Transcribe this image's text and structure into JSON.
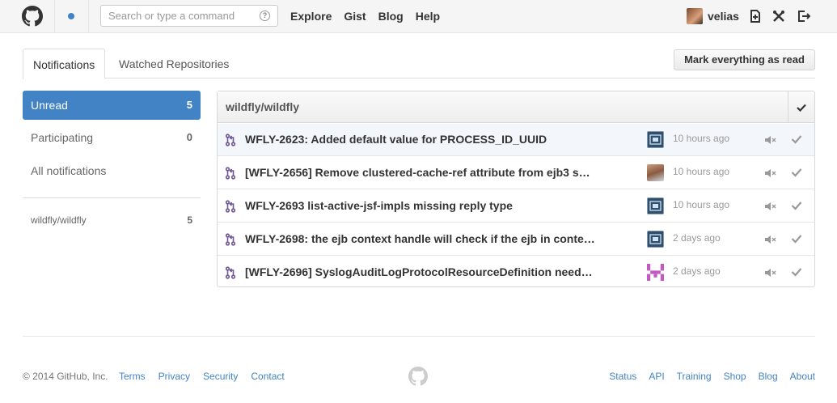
{
  "header": {
    "search_placeholder": "Search or type a command",
    "help_glyph": "?",
    "nav": [
      "Explore",
      "Gist",
      "Blog",
      "Help"
    ],
    "username": "velias",
    "icons": [
      "github-logo-icon",
      "notification-dot-icon",
      "create-repo-icon",
      "settings-icon",
      "sign-out-icon"
    ]
  },
  "tabs": {
    "notifications": "Notifications",
    "watched": "Watched Repositories"
  },
  "mark_all_label": "Mark everything as read",
  "sidebar": {
    "items": [
      {
        "label": "Unread",
        "count": "5"
      },
      {
        "label": "Participating",
        "count": "0"
      },
      {
        "label": "All notifications",
        "count": ""
      }
    ],
    "repos": [
      {
        "label": "wildfly/wildfly",
        "count": "5"
      }
    ]
  },
  "box": {
    "repo": "wildfly/wildfly",
    "rows": [
      {
        "title": "WFLY-2623: Added default value for PROCESS_ID_UUID",
        "time": "10 hours ago",
        "avatar": "as-avatar"
      },
      {
        "title": "[WFLY-2656] Remove clustered-cache-ref attribute from ejb3 s…",
        "time": "10 hours ago",
        "avatar": "photo-avatar"
      },
      {
        "title": "WFLY-2693 list-active-jsf-impls missing reply type",
        "time": "10 hours ago",
        "avatar": "as-avatar"
      },
      {
        "title": "WFLY-2698: the ejb context handle will check if the ejb in conte…",
        "time": "2 days ago",
        "avatar": "as-avatar"
      },
      {
        "title": "[WFLY-2696] SyslogAuditLogProtocolResourceDefinition need…",
        "time": "2 days ago",
        "avatar": "identicon-avatar"
      }
    ]
  },
  "footer": {
    "copyright": "© 2014 GitHub, Inc.",
    "left_links": [
      "Terms",
      "Privacy",
      "Security",
      "Contact"
    ],
    "right_links": [
      "Status",
      "API",
      "Training",
      "Shop",
      "Blog",
      "About"
    ]
  },
  "colors": {
    "accent": "#4183c4",
    "pr_icon": "#6e5494",
    "identicon": "#c25ac2"
  }
}
